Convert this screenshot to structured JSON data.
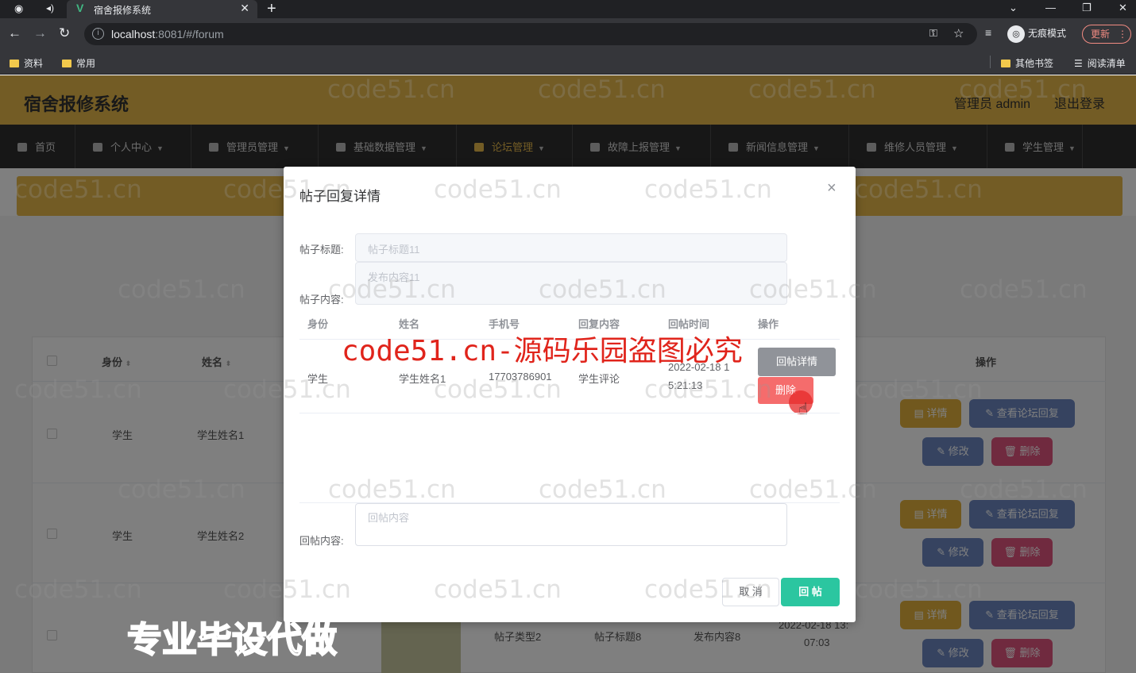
{
  "browser": {
    "tab_title": "宿舍报修系统",
    "url_host": "localhost",
    "url_rest": ":8081/#/forum",
    "incognito_label": "无痕模式",
    "update_label": "更新",
    "bookmarks": [
      "资料",
      "常用"
    ],
    "bookmarks_right": [
      "其他书签",
      "阅读清单"
    ]
  },
  "app": {
    "title": "宿舍报修系统",
    "admin_label": "管理员 admin",
    "logout_label": "退出登录",
    "nav": [
      "首页",
      "个人中心",
      "管理员管理",
      "基础数据管理",
      "论坛管理",
      "故障上报管理",
      "新闻信息管理",
      "维修人员管理",
      "学生管理"
    ]
  },
  "bg_table": {
    "headers": {
      "identity": "身份",
      "name": "姓名",
      "actions": "操作"
    },
    "rows": [
      {
        "identity": "学生",
        "name": "学生姓名1"
      },
      {
        "identity": "学生",
        "name": "学生姓名2"
      },
      {
        "type": "帖子类型2",
        "title": "帖子标题8",
        "content": "发布内容8",
        "time_line1": "2022-02-18 13:",
        "time_line2": "07:03"
      }
    ],
    "btn_detail": "详情",
    "btn_view_replies": "查看论坛回复",
    "btn_edit": "修改",
    "btn_delete": "删除"
  },
  "dialog": {
    "title": "帖子回复详情",
    "close_glyph": "×",
    "post_title_label": "帖子标题:",
    "post_title_value": "帖子标题11",
    "post_content_label": "帖子内容:",
    "post_content_value": "发布内容11",
    "reply_table": {
      "headers": [
        "身份",
        "姓名",
        "手机号",
        "回复内容",
        "回帖时间",
        "操作"
      ],
      "row": {
        "identity": "学生",
        "name": "学生姓名1",
        "phone": "17703786901",
        "content": "学生评论",
        "time_line1": "2022-02-18 1",
        "time_line2": "5:21:13"
      },
      "btn_detail": "回帖详情",
      "btn_delete": "删除"
    },
    "reply_label": "回帖内容:",
    "reply_placeholder": "回帖内容",
    "cancel_label": "取 消",
    "submit_label": "回 帖"
  },
  "watermarks": {
    "site": "code51.cn",
    "red_notice": "code51.cn-源码乐园盗图必究",
    "bottom_notice": "专业毕设代做"
  }
}
